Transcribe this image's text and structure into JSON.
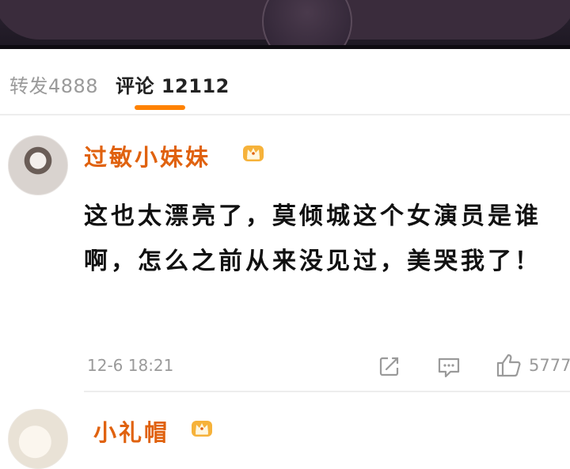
{
  "tabs": {
    "repost_label": "转发4888",
    "comments_label": "评论 12112"
  },
  "comments": [
    {
      "username": "过敏小妹妹",
      "text": "这也太漂亮了，莫倾城这个女演员是谁啊，怎么之前从来没见过，美哭我了！",
      "time": "12-6 18:21",
      "likes": "5777",
      "badge_icon": "crown-vip-icon"
    },
    {
      "username": "小礼帽",
      "badge_icon": "crown-vip-icon"
    }
  ],
  "colors": {
    "accent": "#ff8200",
    "username": "#e0620f",
    "muted": "#9a9a9a"
  }
}
